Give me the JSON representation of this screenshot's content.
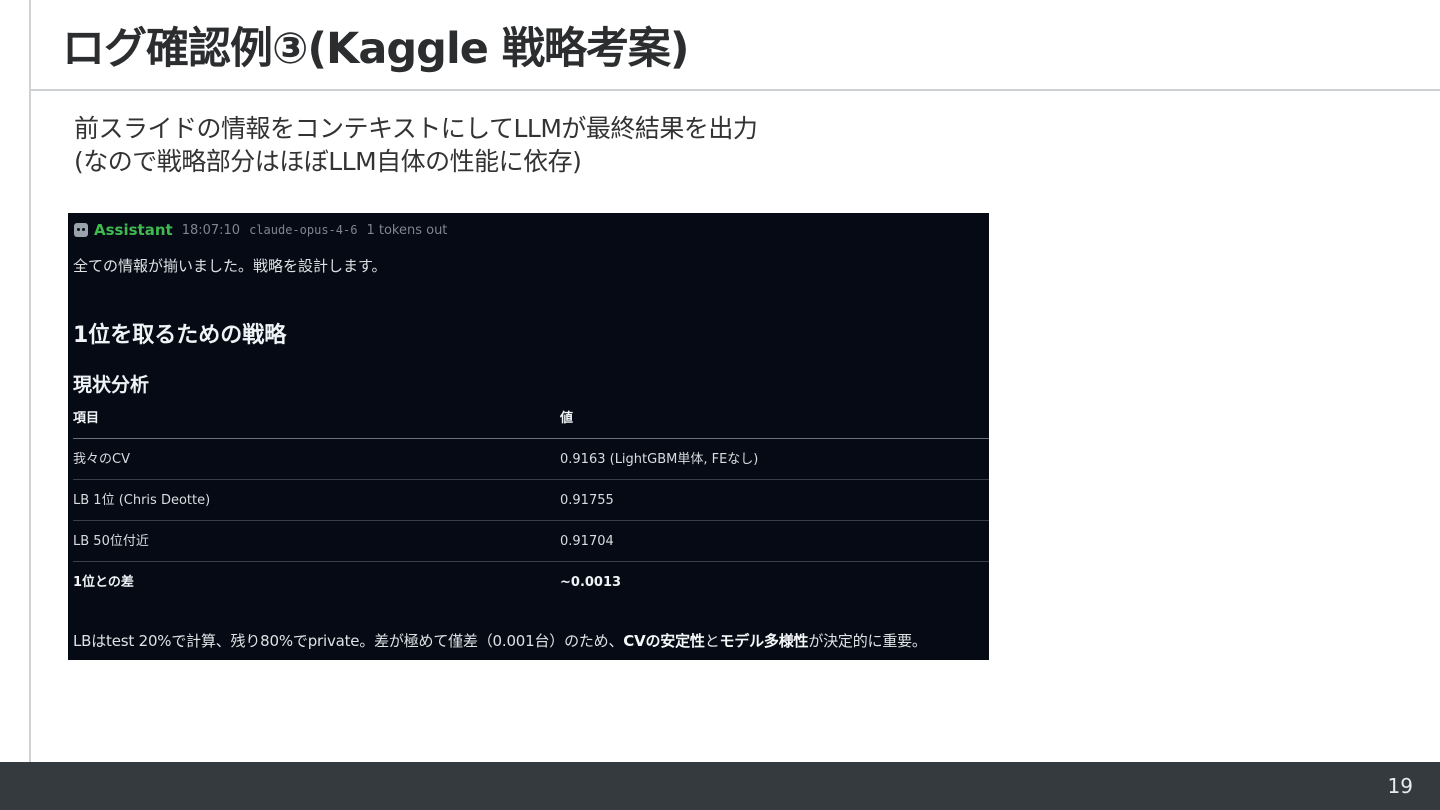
{
  "slide": {
    "title": "ログ確認例③(Kaggle 戦略考案)",
    "subtitle_lines": [
      "前スライドの情報をコンテキストにしてLLMが最終結果を出力",
      "(なので戦略部分はほぼLLM自体の性能に依存)"
    ],
    "page_number": "19"
  },
  "screenshot": {
    "header": {
      "icon": "robot-icon",
      "role": "Assistant",
      "time": "18:07:10",
      "model": "claude-opus-4-6",
      "tokens": "1 tokens out"
    },
    "intro": "全ての情報が揃いました。戦略を設計します。",
    "heading": "1位を取るための戦略",
    "subheading": "現状分析",
    "table": {
      "headers": [
        "項目",
        "値"
      ],
      "rows": [
        [
          "我々のCV",
          "0.9163 (LightGBM単体, FEなし)"
        ],
        [
          "LB 1位 (Chris Deotte)",
          "0.91755"
        ],
        [
          "LB 50位付近",
          "0.91704"
        ],
        [
          "1位との差",
          "~0.0013"
        ]
      ]
    },
    "note": {
      "part1": "LBはtest 20%で計算、残り80%でprivate。差が極めて僅差（0.001台）のため、",
      "bold1": "CVの安定性",
      "part2": "と",
      "bold2": "モデル多様性",
      "part3": "が決定的に重要。"
    }
  },
  "colors": {
    "role_green": "#3fb950",
    "terminal_bg": "#050a14",
    "footer_bg": "#343a3e"
  }
}
